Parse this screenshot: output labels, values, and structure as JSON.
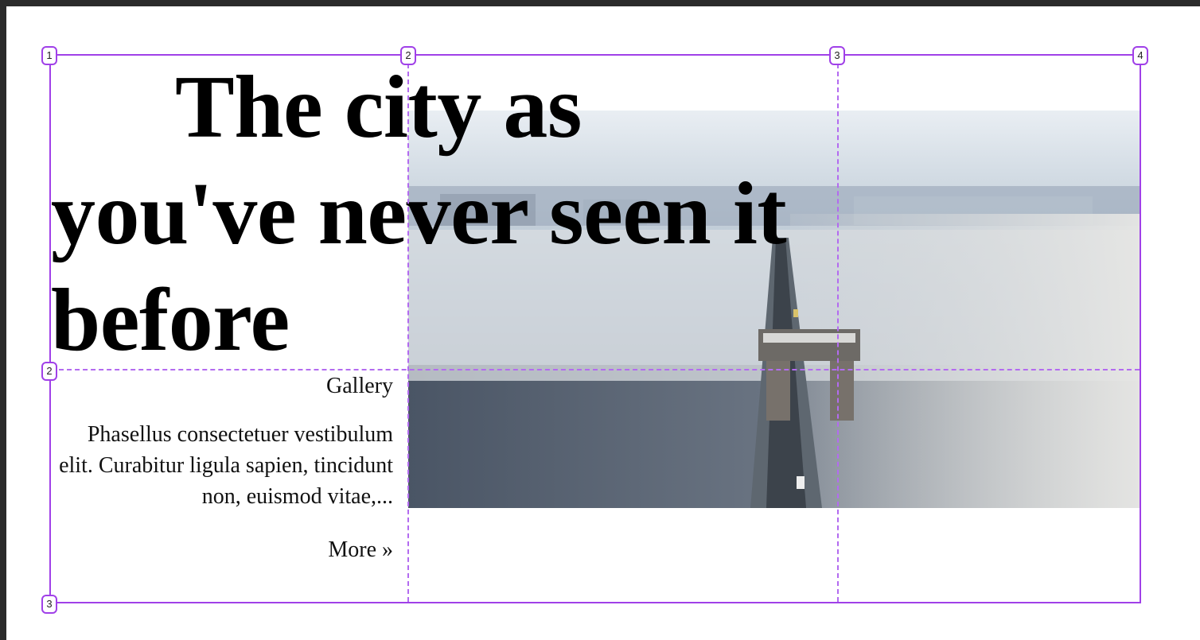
{
  "headline": "The city as you've never seen it before",
  "sidebar": {
    "label": "Gallery",
    "body": "Phasellus consectetuer vestibulum elit. Curabitur ligula sapien, tincidunt non, euismod vitae,...",
    "more_link": "More »"
  },
  "image": {
    "description_icon": "bridge-fog-photo-icon"
  },
  "grid_overlay": {
    "column_numbers": [
      "1",
      "2",
      "3",
      "4"
    ],
    "row_numbers": [
      "2",
      "3"
    ],
    "line_color": "#a040e8"
  }
}
